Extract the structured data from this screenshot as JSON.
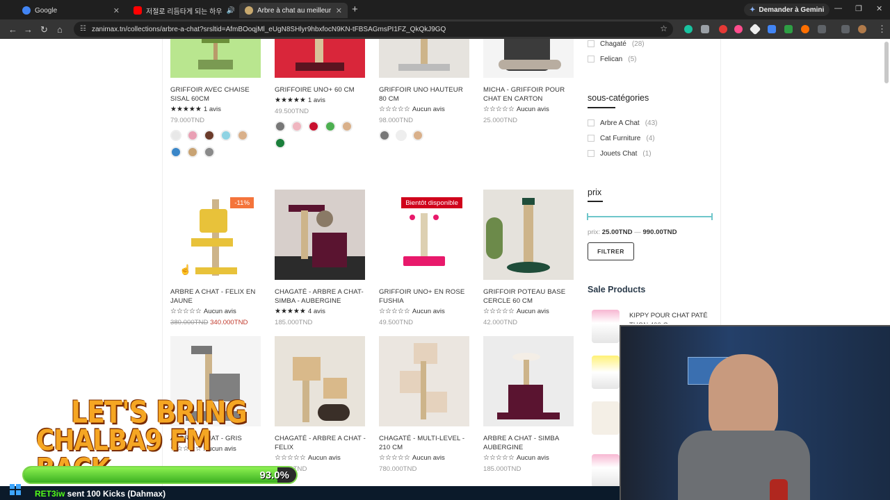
{
  "browser": {
    "tabs": [
      {
        "title": "Google",
        "color": "#4285f4"
      },
      {
        "title": "저절로 리듬타게 되는 하우",
        "color": "#ff0000"
      },
      {
        "title": "Arbre à chat au meilleur prix en",
        "color": "#c8a96e"
      }
    ],
    "gemini_label": "Demander à Gemini",
    "url": "zanimax.tn/collections/arbre-a-chat?srsltid=AfmBOoqjMl_eUgN8SHlyr9hbxfocN9KN-tFBSAGmsPI1FZ_QkQkJ9GQ"
  },
  "products": [
    {
      "name": "GRIFFOIR AVEC CHAISE SISAL 60CM",
      "stars": "★★★★★",
      "reviews": "1 avis",
      "price": "79.000TND",
      "img_color": "#b9e68f",
      "swatches": [
        "#e8e8e8",
        "#e9a0b4",
        "#6b3b2a",
        "#8fd3e3",
        "#d9b08a",
        "#3a86c8",
        "#c8a373",
        "#8a8a8a"
      ]
    },
    {
      "name": "GRIFFOIRE UNO+ 60 CM",
      "stars": "★★★★★",
      "reviews": "1 avis",
      "price": "49.500TND",
      "img_color": "#d9263a",
      "swatches": [
        "#777777",
        "#f0b6c0",
        "#c8102e",
        "#4caf50",
        "#d9b08a",
        "#1b7f3b"
      ]
    },
    {
      "name": "GRIFFOIR UNO HAUTEUR 80 CM",
      "stars": "☆☆☆☆☆",
      "reviews": "Aucun avis",
      "price": "98.000TND",
      "img_color": "#e0ddd7",
      "swatches": [
        "#777777",
        "#eeeeee",
        "#d9b08a"
      ]
    },
    {
      "name": "MICHA - GRIFFOIR POUR CHAT EN CARTON",
      "stars": "☆☆☆☆☆",
      "reviews": "Aucun avis",
      "price": "25.000TND",
      "img_color": "#f2f2f2",
      "swatches": []
    },
    {
      "name": "ARBRE A CHAT - FELIX EN JAUNE",
      "stars": "☆☆☆☆☆",
      "reviews": "Aucun avis",
      "old_price": "380.000TND",
      "price": "340.000TND",
      "badge": "-11%",
      "badge_color": "#f4743b",
      "img_color": "#ffffff",
      "swatches": []
    },
    {
      "name": "CHAGATÉ - ARBRE A CHAT-SIMBA - AUBERGINE",
      "stars": "★★★★★",
      "reviews": "4 avis",
      "price": "185.000TND",
      "img_color": "#d7cfcb",
      "swatches": []
    },
    {
      "name": "GRIFFOIR UNO+ EN ROSE FUSHIA",
      "stars": "☆☆☆☆☆",
      "reviews": "Aucun avis",
      "price": "49.500TND",
      "badge": "Bientôt disponible",
      "badge_color": "#d0021b",
      "img_color": "#ffffff",
      "swatches": []
    },
    {
      "name": "GRIFFOIR POTEAU BASE CERCLE 60 CM",
      "stars": "☆☆☆☆☆",
      "reviews": "Aucun avis",
      "price": "42.000TND",
      "img_color": "#e5e2dc",
      "swatches": []
    },
    {
      "name": "ARBRE A CHAT - GRIS",
      "stars": "☆☆☆☆☆",
      "reviews": "Aucun avis",
      "price": "",
      "img_color": "#f4f4f4",
      "swatches": []
    },
    {
      "name": "CHAGATÉ - ARBRE A CHAT - FELIX",
      "stars": "☆☆☆☆☆",
      "reviews": "Aucun avis",
      "price": "1..000TND",
      "img_color": "#e8e3da",
      "swatches": []
    },
    {
      "name": "CHAGATÉ - MULTI-LEVEL - 210 CM",
      "stars": "☆☆☆☆☆",
      "reviews": "Aucun avis",
      "price": "780.000TND",
      "img_color": "#ebe6e0",
      "swatches": []
    },
    {
      "name": "ARBRE A CHAT - SIMBA AUBERGINE",
      "stars": "☆☆☆☆☆",
      "reviews": "Aucun avis",
      "price": "185.000TND",
      "img_color": "#ececec",
      "swatches": []
    }
  ],
  "sidebar": {
    "brands": [
      {
        "label": "Chagaté",
        "count": "(28)"
      },
      {
        "label": "Felican",
        "count": "(5)"
      }
    ],
    "subcat_title": "sous-catégories",
    "subcats": [
      {
        "label": "Arbre A Chat",
        "count": "(43)"
      },
      {
        "label": "Cat Furniture",
        "count": "(4)"
      },
      {
        "label": "Jouets Chat",
        "count": "(1)"
      }
    ],
    "price_title": "prix",
    "price_label": "prix:",
    "price_min": "25.00TND",
    "price_sep": "—",
    "price_max": "990.00TND",
    "filter_button": "FILTRER",
    "sale_title": "Sale Products",
    "sale_items": [
      {
        "name": "KIPPY POUR CHAT PATÉ THON 400 G"
      }
    ]
  },
  "stream": {
    "banner_line1": "LET'S BRING",
    "banner_line2": "CHALBA9 FM BACK",
    "progress_pct": "93.0%",
    "progress_value": 0.93,
    "kick_user": "RET3iw",
    "kick_text": " sent 100 Kicks (Dahmax)"
  }
}
